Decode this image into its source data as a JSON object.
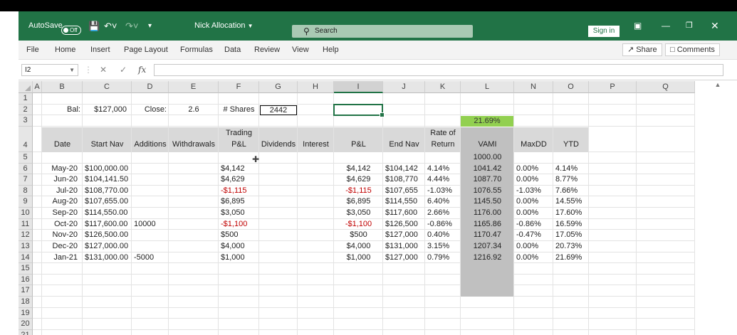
{
  "titlebar": {
    "autosave_label": "AutoSave",
    "autosave_state": "Off",
    "file_name": "Nick Allocation",
    "search_placeholder": "Search",
    "sign_in": "Sign in"
  },
  "ribbon": {
    "menus": [
      "File",
      "Home",
      "Insert",
      "Page Layout",
      "Formulas",
      "Data",
      "Review",
      "View",
      "Help"
    ],
    "share": "Share",
    "comments": "Comments"
  },
  "formula_bar": {
    "name_box": "I2",
    "fx": "fx",
    "content": ""
  },
  "columns": [
    "A",
    "B",
    "C",
    "D",
    "E",
    "F",
    "G",
    "H",
    "I",
    "J",
    "K",
    "L",
    "N",
    "O",
    "P",
    "Q"
  ],
  "rows": [
    "1",
    "2",
    "3",
    "4",
    "5",
    "6",
    "7",
    "8",
    "9",
    "10",
    "11",
    "12",
    "13",
    "14",
    "15",
    "16",
    "17",
    "18",
    "19",
    "20",
    "21"
  ],
  "row2": {
    "bal_label": "Bal:",
    "bal_value": "$127,000",
    "close_label": "Close:",
    "close_value": "2.6",
    "shares_label": "# Shares",
    "shares_value": "2442"
  },
  "row3": {
    "ytd_total": "21.69%"
  },
  "headers": {
    "date": "Date",
    "start_nav": "Start Nav",
    "additions": "Additions",
    "withdrawals": "Withdrawals",
    "trading_pl_1": "Trading",
    "trading_pl_2": "P&L",
    "dividends": "Dividends",
    "interest": "Interest",
    "pl": "P&L",
    "end_nav": "End Nav",
    "ror_1": "Rate of",
    "ror_2": "Return",
    "vami": "VAMI",
    "maxdd": "MaxDD",
    "ytd": "YTD"
  },
  "vami_start": "1000.00",
  "table": [
    {
      "date": "May-20",
      "start_nav": "$100,000.00",
      "additions": "",
      "withdrawals": "",
      "trading_pl": "$4,142",
      "trading_neg": false,
      "pl": "$4,142",
      "pl_neg": false,
      "end_nav": "$104,142",
      "ror": "4.14%",
      "vami": "1041.42",
      "maxdd": "0.00%",
      "ytd": "4.14%"
    },
    {
      "date": "Jun-20",
      "start_nav": "$104,141.50",
      "additions": "",
      "withdrawals": "",
      "trading_pl": "$4,629",
      "trading_neg": false,
      "pl": "$4,629",
      "pl_neg": false,
      "end_nav": "$108,770",
      "ror": "4.44%",
      "vami": "1087.70",
      "maxdd": "0.00%",
      "ytd": "8.77%"
    },
    {
      "date": "Jul-20",
      "start_nav": "$108,770.00",
      "additions": "",
      "withdrawals": "",
      "trading_pl": "-$1,115",
      "trading_neg": true,
      "pl": "-$1,115",
      "pl_neg": true,
      "end_nav": "$107,655",
      "ror": "-1.03%",
      "vami": "1076.55",
      "maxdd": "-1.03%",
      "ytd": "7.66%"
    },
    {
      "date": "Aug-20",
      "start_nav": "$107,655.00",
      "additions": "",
      "withdrawals": "",
      "trading_pl": "$6,895",
      "trading_neg": false,
      "pl": "$6,895",
      "pl_neg": false,
      "end_nav": "$114,550",
      "ror": "6.40%",
      "vami": "1145.50",
      "maxdd": "0.00%",
      "ytd": "14.55%"
    },
    {
      "date": "Sep-20",
      "start_nav": "$114,550.00",
      "additions": "",
      "withdrawals": "",
      "trading_pl": "$3,050",
      "trading_neg": false,
      "pl": "$3,050",
      "pl_neg": false,
      "end_nav": "$117,600",
      "ror": "2.66%",
      "vami": "1176.00",
      "maxdd": "0.00%",
      "ytd": "17.60%"
    },
    {
      "date": "Oct-20",
      "start_nav": "$117,600.00",
      "additions": "10000",
      "withdrawals": "",
      "trading_pl": "-$1,100",
      "trading_neg": true,
      "pl": "-$1,100",
      "pl_neg": true,
      "end_nav": "$126,500",
      "ror": "-0.86%",
      "vami": "1165.86",
      "maxdd": "-0.86%",
      "ytd": "16.59%"
    },
    {
      "date": "Nov-20",
      "start_nav": "$126,500.00",
      "additions": "",
      "withdrawals": "",
      "trading_pl": "$500",
      "trading_neg": false,
      "pl": "$500",
      "pl_neg": false,
      "end_nav": "$127,000",
      "ror": "0.40%",
      "vami": "1170.47",
      "maxdd": "-0.47%",
      "ytd": "17.05%"
    },
    {
      "date": "Dec-20",
      "start_nav": "$127,000.00",
      "additions": "",
      "withdrawals": "",
      "trading_pl": "$4,000",
      "trading_neg": false,
      "pl": "$4,000",
      "pl_neg": false,
      "end_nav": "$131,000",
      "ror": "3.15%",
      "vami": "1207.34",
      "maxdd": "0.00%",
      "ytd": "20.73%"
    },
    {
      "date": "Jan-21",
      "start_nav": "$131,000.00",
      "additions": "-5000",
      "withdrawals": "",
      "trading_pl": "$1,000",
      "trading_neg": false,
      "pl": "$1,000",
      "pl_neg": false,
      "end_nav": "$127,000",
      "ror": "0.79%",
      "vami": "1216.92",
      "maxdd": "0.00%",
      "ytd": "21.69%"
    }
  ]
}
